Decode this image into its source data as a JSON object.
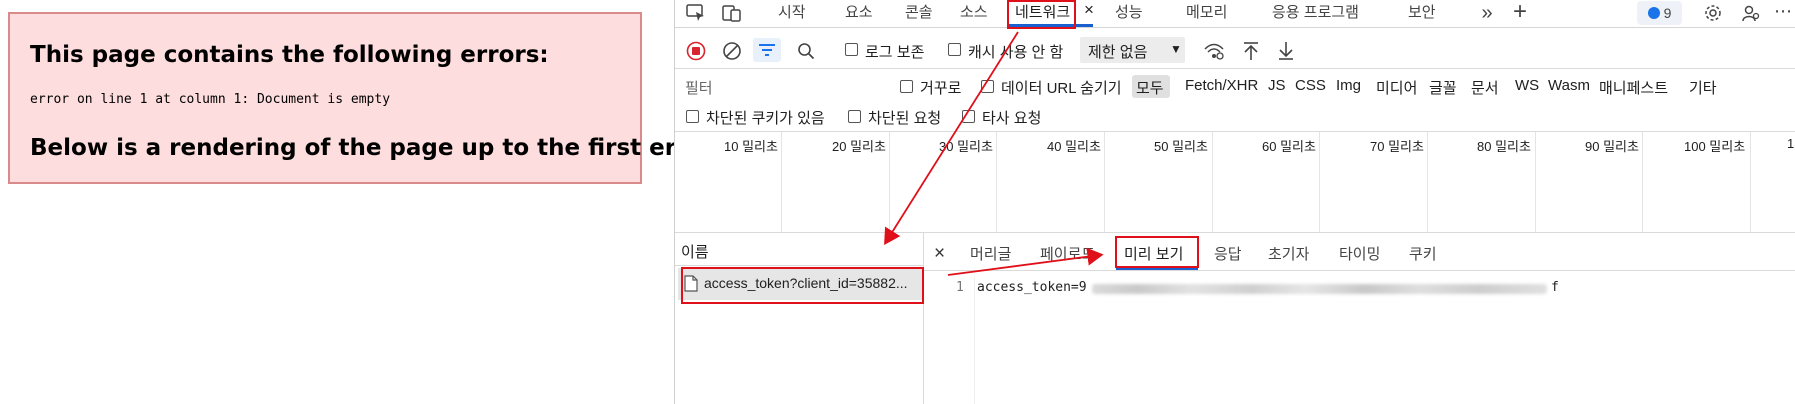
{
  "error_box": {
    "title": "This page contains the following errors:",
    "message": "error on line 1 at column 1: Document is empty",
    "footer": "Below is a rendering of the page up to the first error."
  },
  "devtools": {
    "tabs": [
      "시작",
      "요소",
      "콘솔",
      "소스",
      "네트워크",
      "성능",
      "메모리",
      "응용 프로그램",
      "보안"
    ],
    "active_tab": "네트워크",
    "close_tab_glyph": "×",
    "issues_count": "9",
    "toolbar": {
      "preserve_log": "로그 보존",
      "disable_cache": "캐시 사용 안 함",
      "throttle": "제한 없음"
    },
    "filter": {
      "placeholder": "필터",
      "invert": "거꾸로",
      "hide_data_urls": "데이터 URL 숨기기",
      "types": [
        "모두",
        "Fetch/XHR",
        "JS",
        "CSS",
        "Img",
        "미디어",
        "글꼴",
        "문서",
        "WS",
        "Wasm",
        "매니페스트",
        "기타"
      ],
      "blocked_cookies": "차단된 쿠키가 있음",
      "blocked_requests": "차단된 요청",
      "third_party": "타사 요청"
    },
    "timeline_ticks": [
      "10 밀리초",
      "20 밀리초",
      "30 밀리초",
      "40 밀리초",
      "50 밀리초",
      "60 밀리초",
      "70 밀리초",
      "80 밀리초",
      "90 밀리초",
      "100 밀리초",
      "1"
    ],
    "requests": {
      "name_header": "이름",
      "items": [
        {
          "name": "access_token?client_id=35882..."
        }
      ]
    },
    "detail": {
      "close_glyph": "×",
      "tabs": [
        "머리글",
        "페이로드",
        "미리 보기",
        "응답",
        "초기자",
        "타이밍",
        "쿠키"
      ],
      "active_tab": "미리 보기",
      "line_number": "1",
      "preview_prefix": "access_token=9",
      "preview_suffix": "f"
    }
  },
  "colors": {
    "annotation_red": "#e0101a",
    "active_underline": "#1a5fd0",
    "error_bg": "#fddddd",
    "record_red": "#d9232e"
  }
}
